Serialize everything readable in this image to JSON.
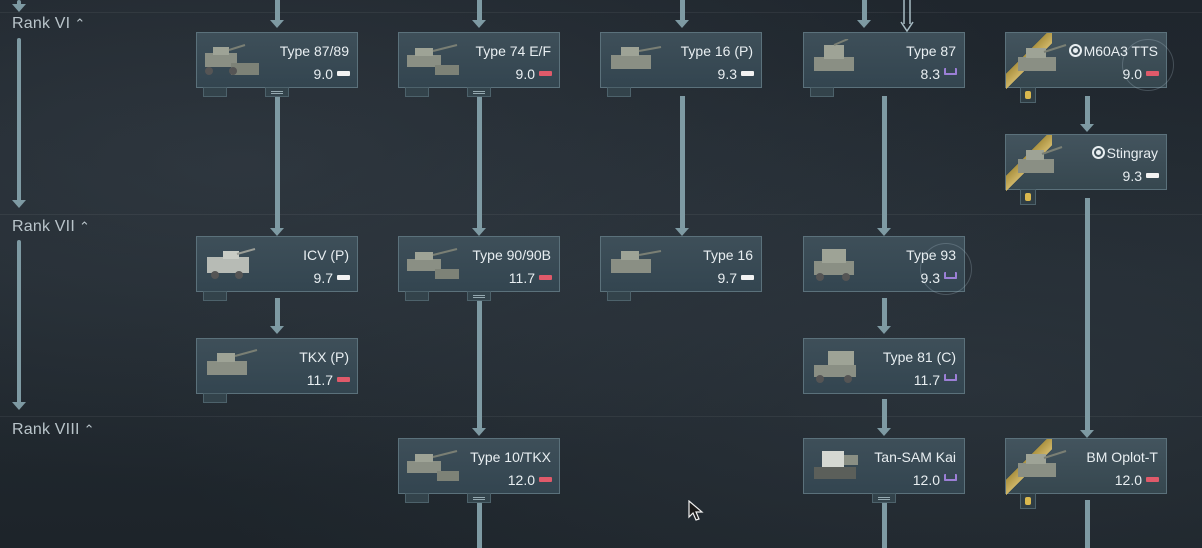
{
  "ranks": [
    {
      "label": "Rank VI"
    },
    {
      "label": "Rank VII"
    },
    {
      "label": "Rank VIII"
    }
  ],
  "vehicles": {
    "type87_89": {
      "name": "Type 87/89",
      "br": "9.0",
      "flag": "white"
    },
    "type74ef": {
      "name": "Type 74 E/F",
      "br": "9.0",
      "flag": "red"
    },
    "type16p": {
      "name": "Type 16 (P)",
      "br": "9.3",
      "flag": "white"
    },
    "type87": {
      "name": "Type 87",
      "br": "8.3",
      "flag": "purple"
    },
    "m60a3tts": {
      "name": "M60A3 TTS",
      "br": "9.0",
      "flag": "red"
    },
    "stingray": {
      "name": "Stingray",
      "br": "9.3",
      "flag": "white"
    },
    "icvp": {
      "name": "ICV (P)",
      "br": "9.7",
      "flag": "white"
    },
    "type90": {
      "name": "Type 90/90B",
      "br": "11.7",
      "flag": "red"
    },
    "type16": {
      "name": "Type 16",
      "br": "9.7",
      "flag": "white"
    },
    "type93": {
      "name": "Type 93",
      "br": "9.3",
      "flag": "purple"
    },
    "tkxp": {
      "name": "TKX (P)",
      "br": "11.7",
      "flag": "red"
    },
    "type81c": {
      "name": "Type 81 (C)",
      "br": "11.7",
      "flag": "purple"
    },
    "type10": {
      "name": "Type 10/TKX",
      "br": "12.0",
      "flag": "red"
    },
    "tansam": {
      "name": "Tan-SAM Kai",
      "br": "12.0",
      "flag": "purple"
    },
    "oplot": {
      "name": "BM Oplot-T",
      "br": "12.0",
      "flag": "red"
    }
  },
  "colors": {
    "link": "#7e9aa3",
    "card_bg": "#3a4c56",
    "flag_red": "#e05a6a",
    "flag_white": "#f2f2f2",
    "flag_purple": "#9b7fd6",
    "premium_gold": "#d9b84e"
  },
  "icons": [
    "tank-thumbnail-icon",
    "folder-icon",
    "squad-target-icon",
    "medal-icon",
    "cursor-icon",
    "chevron-up-icon"
  ]
}
